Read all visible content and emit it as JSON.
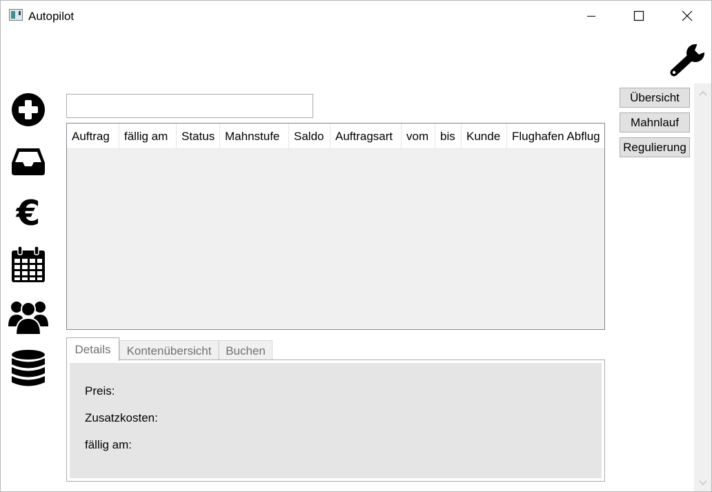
{
  "window": {
    "title": "Autopilot"
  },
  "search": {
    "value": "",
    "placeholder": ""
  },
  "grid": {
    "columns": [
      "Auftrag",
      "fällig am",
      "Status",
      "Mahnstufe",
      "Saldo",
      "Auftragsart",
      "vom",
      "bis",
      "Kunde",
      "Flughafen Abflug"
    ],
    "rows": []
  },
  "tabs": [
    "Details",
    "Kontenübersicht",
    "Buchen"
  ],
  "details": {
    "preis_label": "Preis:",
    "zusatzkosten_label": "Zusatzkosten:",
    "faellig_label": "fällig am:"
  },
  "buttons": {
    "uebersicht": "Übersicht",
    "mahnlauf": "Mahnlauf",
    "regulierung": "Regulierung"
  },
  "sidebar_icons": [
    "plus-circle-icon",
    "inbox-icon",
    "euro-icon",
    "calendar-icon",
    "users-icon",
    "database-icon"
  ],
  "colors": {
    "accent_border": "#828790",
    "button_bg": "#e1e1e1",
    "panel_bg": "#e5e5e5"
  }
}
